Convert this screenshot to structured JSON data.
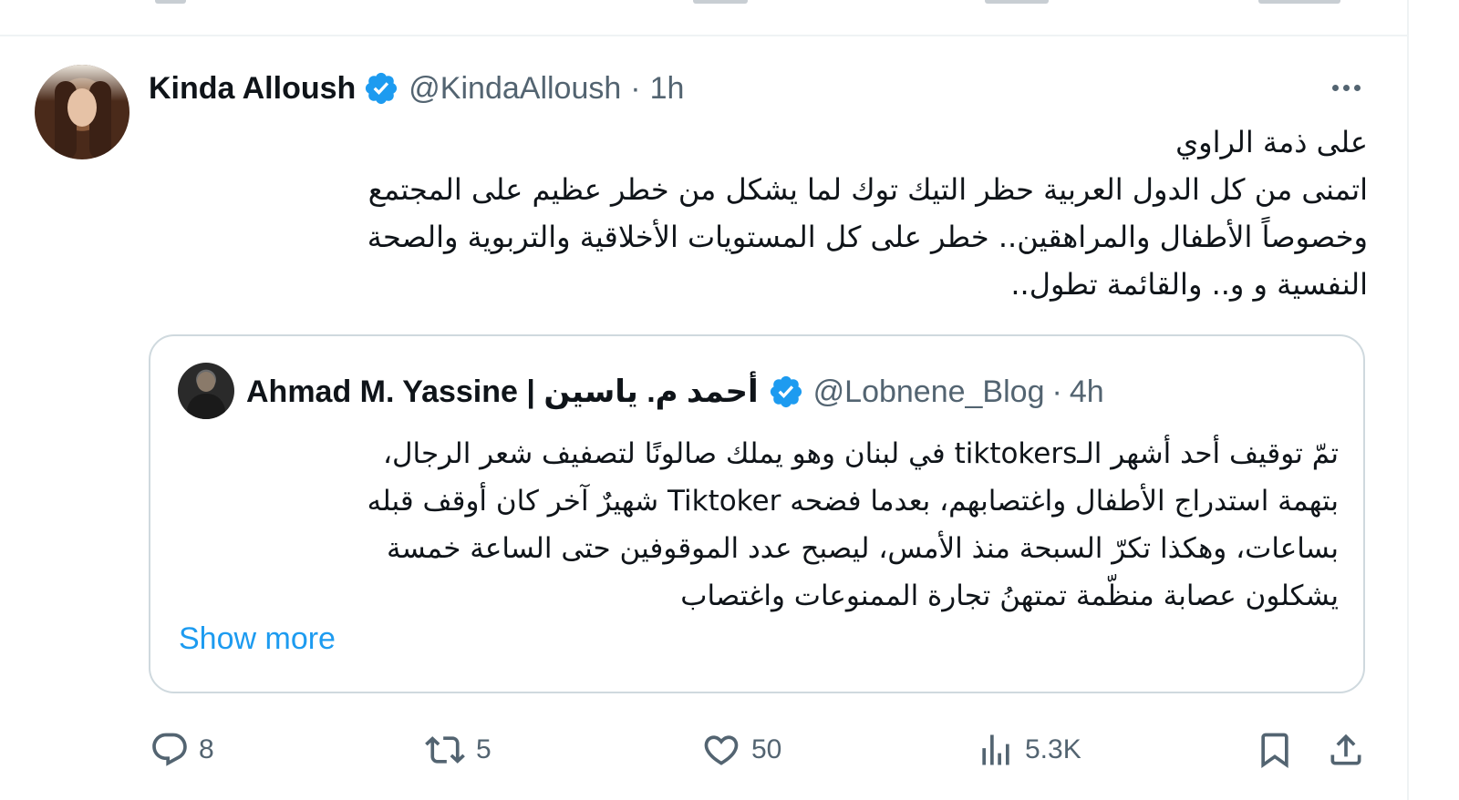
{
  "tweet": {
    "author_name": "Kinda Alloush",
    "handle": "@KindaAlloush",
    "separator": "·",
    "time": "1h",
    "text_lines": [
      "على ذمة الراوي",
      "اتمنى من كل الدول العربية حظر التيك توك لما يشكل من خطر عظيم على المجتمع",
      "وخصوصاً الأطفال والمراهقين.. خطر على كل المستويات الأخلاقية والتربوية والصحة",
      "النفسية و و.. والقائمة تطول.."
    ]
  },
  "quoted": {
    "author_name": "Ahmad M. Yassine | أحمد م. ياسين",
    "handle": "@Lobnene_Blog",
    "separator": "·",
    "time": "4h",
    "text_lines": [
      "تمّ توقيف أحد أشهر الـtiktokers في لبنان وهو يملك صالونًا لتصفيف شعر الرجال،",
      "بتهمة استدراج الأطفال واغتصابهم، بعدما فضحه Tiktoker شهيرٌ آخر كان أوقف قبله",
      "بساعات، وهكذا تكرّ السبحة منذ الأمس، ليصبح عدد الموقوفين حتى الساعة خمسة",
      "يشكلون عصابة منظّمة تمتهنُ تجارة الممنوعات واغتصاب"
    ],
    "show_more": "Show more"
  },
  "actions": {
    "replies": "8",
    "reposts": "5",
    "likes": "50",
    "views": "5.3K"
  },
  "icons": {
    "verified": "verified-badge-icon",
    "more": "more-icon",
    "reply": "reply-icon",
    "repost": "repost-icon",
    "like": "like-icon",
    "views": "views-icon",
    "bookmark": "bookmark-icon",
    "share": "share-icon"
  },
  "colors": {
    "verified_blue": "#1d9bf0",
    "link_blue": "#1d9bf0",
    "secondary_text": "#536471",
    "border": "#cfd9de"
  }
}
